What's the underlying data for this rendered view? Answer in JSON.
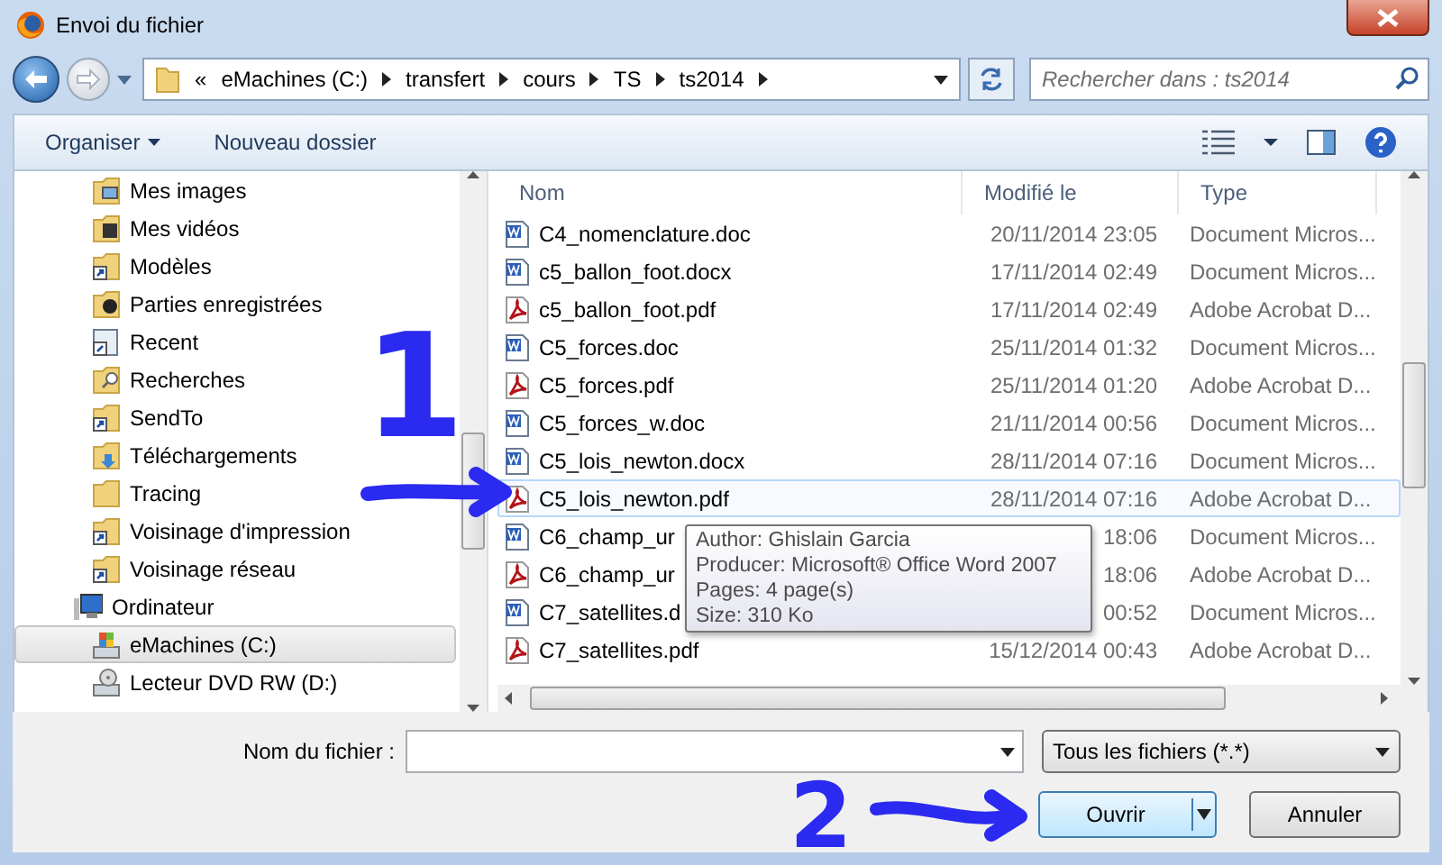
{
  "window": {
    "title": "Envoi du fichier"
  },
  "address_bar": {
    "crumbs": [
      "«",
      "eMachines (C:)",
      "transfert",
      "cours",
      "TS",
      "ts2014"
    ]
  },
  "search": {
    "placeholder": "Rechercher dans : ts2014"
  },
  "toolbar": {
    "organize": "Organiser",
    "new_folder": "Nouveau dossier"
  },
  "nav": {
    "upper_items": [
      {
        "label": "Mes images",
        "kind": "pictures",
        "selected": false
      },
      {
        "label": "Mes vidéos",
        "kind": "videos",
        "selected": false
      },
      {
        "label": "Modèles",
        "kind": "shortcut",
        "selected": false
      },
      {
        "label": "Parties enregistrées",
        "kind": "games",
        "selected": false
      },
      {
        "label": "Recent",
        "kind": "recent",
        "selected": false
      },
      {
        "label": "Recherches",
        "kind": "searches",
        "selected": false
      },
      {
        "label": "SendTo",
        "kind": "shortcut",
        "selected": false
      },
      {
        "label": "Téléchargements",
        "kind": "downloads",
        "selected": false
      },
      {
        "label": "Tracing",
        "kind": "folder",
        "selected": false
      },
      {
        "label": "Voisinage d'impression",
        "kind": "shortcut",
        "selected": false
      },
      {
        "label": "Voisinage réseau",
        "kind": "shortcut",
        "selected": false
      }
    ],
    "tree": [
      {
        "label": "Ordinateur",
        "kind": "computer",
        "selected": false,
        "children": [
          {
            "label": "eMachines (C:)",
            "kind": "drive",
            "selected": true
          },
          {
            "label": "Lecteur DVD RW (D:)",
            "kind": "dvd",
            "selected": false
          }
        ]
      }
    ]
  },
  "files": {
    "columns": [
      "Nom",
      "Modifié le",
      "Type"
    ],
    "rows": [
      {
        "name": "C4_nomenclature.doc",
        "date": "20/11/2014 23:05",
        "type": "Document Micros...",
        "kind": "word",
        "highlighted": false
      },
      {
        "name": "c5_ballon_foot.docx",
        "date": "17/11/2014 02:49",
        "type": "Document Micros...",
        "kind": "word",
        "highlighted": false
      },
      {
        "name": "c5_ballon_foot.pdf",
        "date": "17/11/2014 02:49",
        "type": "Adobe Acrobat D...",
        "kind": "pdf",
        "highlighted": false
      },
      {
        "name": "C5_forces.doc",
        "date": "25/11/2014 01:32",
        "type": "Document Micros...",
        "kind": "word",
        "highlighted": false
      },
      {
        "name": "C5_forces.pdf",
        "date": "25/11/2014 01:20",
        "type": "Adobe Acrobat D...",
        "kind": "pdf",
        "highlighted": false
      },
      {
        "name": "C5_forces_w.doc",
        "date": "21/11/2014 00:56",
        "type": "Document Micros...",
        "kind": "word",
        "highlighted": false
      },
      {
        "name": "C5_lois_newton.docx",
        "date": "28/11/2014 07:16",
        "type": "Document Micros...",
        "kind": "word",
        "highlighted": false
      },
      {
        "name": "C5_lois_newton.pdf",
        "date": "28/11/2014 07:16",
        "type": "Adobe Acrobat D...",
        "kind": "pdf",
        "highlighted": true
      },
      {
        "name": "C6_champ_ur",
        "date": "18:06",
        "type": "Document Micros...",
        "kind": "word",
        "highlighted": false
      },
      {
        "name": "C6_champ_ur",
        "date": "18:06",
        "type": "Adobe Acrobat D...",
        "kind": "pdf",
        "highlighted": false
      },
      {
        "name": "C7_satellites.d",
        "date": "00:52",
        "type": "Document Micros...",
        "kind": "word",
        "highlighted": false
      },
      {
        "name": "C7_satellites.pdf",
        "date": "15/12/2014 00:43",
        "type": "Adobe Acrobat D...",
        "kind": "pdf",
        "highlighted": false
      }
    ]
  },
  "tooltip": {
    "lines": [
      "Author: Ghislain Garcia",
      "Producer: Microsoft® Office Word 2007",
      "Pages: 4 page(s)",
      "Size: 310 Ko"
    ]
  },
  "footer": {
    "filename_label": "Nom du fichier :",
    "filetype": "Tous les fichiers (*.*)",
    "open": "Ouvrir",
    "cancel": "Annuler"
  },
  "annotations": [
    {
      "kind": "digit",
      "text": "1"
    },
    {
      "kind": "arrow"
    },
    {
      "kind": "digit",
      "text": "2"
    },
    {
      "kind": "arrow"
    }
  ]
}
